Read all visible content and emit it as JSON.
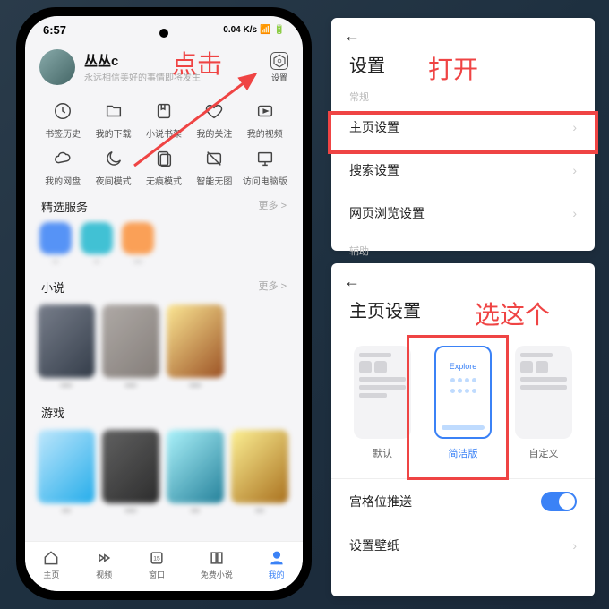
{
  "status": {
    "time": "6:57",
    "net": "0.04 K/s",
    "sig": "⁵ᴳ ⁴⁶ ◂▮▯"
  },
  "profile": {
    "name": "丛丛c",
    "sub": "永远相信美好的事情即将发生"
  },
  "settings_btn": "设置",
  "row1": [
    {
      "label": "书签历史"
    },
    {
      "label": "我的下载"
    },
    {
      "label": "小说书架"
    },
    {
      "label": "我的关注"
    },
    {
      "label": "我的视频"
    }
  ],
  "row2": [
    {
      "label": "我的网盘"
    },
    {
      "label": "夜间模式"
    },
    {
      "label": "无痕模式"
    },
    {
      "label": "智能无图"
    },
    {
      "label": "访问电脑版"
    }
  ],
  "sections": {
    "featured": "精选服务",
    "novel": "小说",
    "game": "游戏",
    "more": "更多 >"
  },
  "tabs": [
    {
      "label": "主页"
    },
    {
      "label": "视频"
    },
    {
      "label": "窗口",
      "badge": "15"
    },
    {
      "label": "免费小说"
    },
    {
      "label": "我的"
    }
  ],
  "callouts": {
    "click": "点击",
    "open": "打开",
    "choose": "选这个"
  },
  "panel1": {
    "title": "设置",
    "cat1": "常规",
    "items": [
      "主页设置",
      "搜索设置",
      "网页浏览设置"
    ],
    "cat2": "辅助"
  },
  "panel2": {
    "title": "主页设置",
    "options": [
      "默认",
      "简洁版",
      "自定义"
    ],
    "explore": "Explore",
    "push": "宫格位推送",
    "wallpaper": "设置壁纸"
  }
}
